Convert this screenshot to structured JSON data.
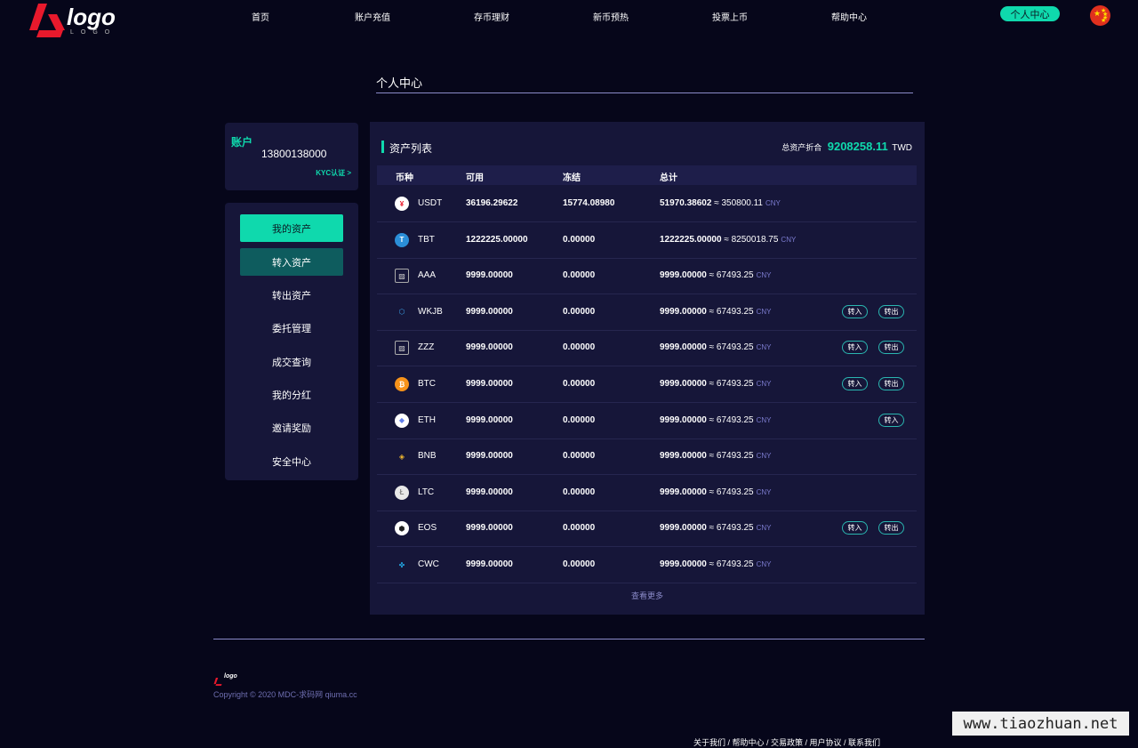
{
  "header": {
    "logo_text": "logo",
    "logo_sub": "LOGO",
    "nav": [
      "首页",
      "账户充值",
      "存币理财",
      "新币预热",
      "投票上币",
      "帮助中心"
    ],
    "personal_center": "个人中心",
    "language_flag": "cn-flag-icon"
  },
  "page": {
    "title": "个人中心"
  },
  "account": {
    "label": "账户",
    "phone": "13800138000",
    "kyc": "KYC认证 >"
  },
  "menu": [
    "我的资产",
    "转入资产",
    "转出资产",
    "委托管理",
    "成交查询",
    "我的分红",
    "邀请奖励",
    "安全中心"
  ],
  "assets": {
    "title": "资产列表",
    "total_label": "总资产折合",
    "total_value": "9208258.11",
    "total_unit": "TWD",
    "columns": [
      "币种",
      "可用",
      "冻结",
      "总计"
    ],
    "rows": [
      {
        "icon": "usdt-icon",
        "symbol": "USDT",
        "available": "36196.29622",
        "frozen": "15774.08980",
        "total": "51970.38602",
        "approx": "≈ 350800.11",
        "unit": "CNY",
        "in": "",
        "out": ""
      },
      {
        "icon": "tbt-icon",
        "symbol": "TBT",
        "available": "1222225.00000",
        "frozen": "0.00000",
        "total": "1222225.00000",
        "approx": "≈ 8250018.75",
        "unit": "CNY",
        "in": "",
        "out": ""
      },
      {
        "icon": "broken-image-icon",
        "symbol": "AAA",
        "available": "9999.00000",
        "frozen": "0.00000",
        "total": "9999.00000",
        "approx": "≈ 67493.25",
        "unit": "CNY",
        "in": "",
        "out": ""
      },
      {
        "icon": "wkjb-icon",
        "symbol": "WKJB",
        "available": "9999.00000",
        "frozen": "0.00000",
        "total": "9999.00000",
        "approx": "≈ 67493.25",
        "unit": "CNY",
        "in": "转入",
        "out": "转出"
      },
      {
        "icon": "broken-image-icon",
        "symbol": "ZZZ",
        "available": "9999.00000",
        "frozen": "0.00000",
        "total": "9999.00000",
        "approx": "≈ 67493.25",
        "unit": "CNY",
        "in": "转入",
        "out": "转出"
      },
      {
        "icon": "btc-icon",
        "symbol": "BTC",
        "available": "9999.00000",
        "frozen": "0.00000",
        "total": "9999.00000",
        "approx": "≈ 67493.25",
        "unit": "CNY",
        "in": "转入",
        "out": "转出"
      },
      {
        "icon": "eth-icon",
        "symbol": "ETH",
        "available": "9999.00000",
        "frozen": "0.00000",
        "total": "9999.00000",
        "approx": "≈ 67493.25",
        "unit": "CNY",
        "in": "",
        "out": "转入"
      },
      {
        "icon": "bnb-icon",
        "symbol": "BNB",
        "available": "9999.00000",
        "frozen": "0.00000",
        "total": "9999.00000",
        "approx": "≈ 67493.25",
        "unit": "CNY",
        "in": "",
        "out": ""
      },
      {
        "icon": "ltc-icon",
        "symbol": "LTC",
        "available": "9999.00000",
        "frozen": "0.00000",
        "total": "9999.00000",
        "approx": "≈ 67493.25",
        "unit": "CNY",
        "in": "",
        "out": ""
      },
      {
        "icon": "eos-icon",
        "symbol": "EOS",
        "available": "9999.00000",
        "frozen": "0.00000",
        "total": "9999.00000",
        "approx": "≈ 67493.25",
        "unit": "CNY",
        "in": "转入",
        "out": "转出"
      },
      {
        "icon": "cwc-icon",
        "symbol": "CWC",
        "available": "9999.00000",
        "frozen": "0.00000",
        "total": "9999.00000",
        "approx": "≈ 67493.25",
        "unit": "CNY",
        "in": "",
        "out": ""
      }
    ],
    "more": "查看更多"
  },
  "footer": {
    "logo_text": "logo",
    "copyright": "Copyright © 2020 MDC-求码网 qiuma.cc",
    "links": "关于我们 / 帮助中心 / 交易政策 / 用户协议 / 联系我们"
  },
  "watermark": "www.tiaozhuan.net",
  "colors": {
    "accent": "#0fd9ad",
    "background": "#06061a",
    "panel": "#161639"
  }
}
